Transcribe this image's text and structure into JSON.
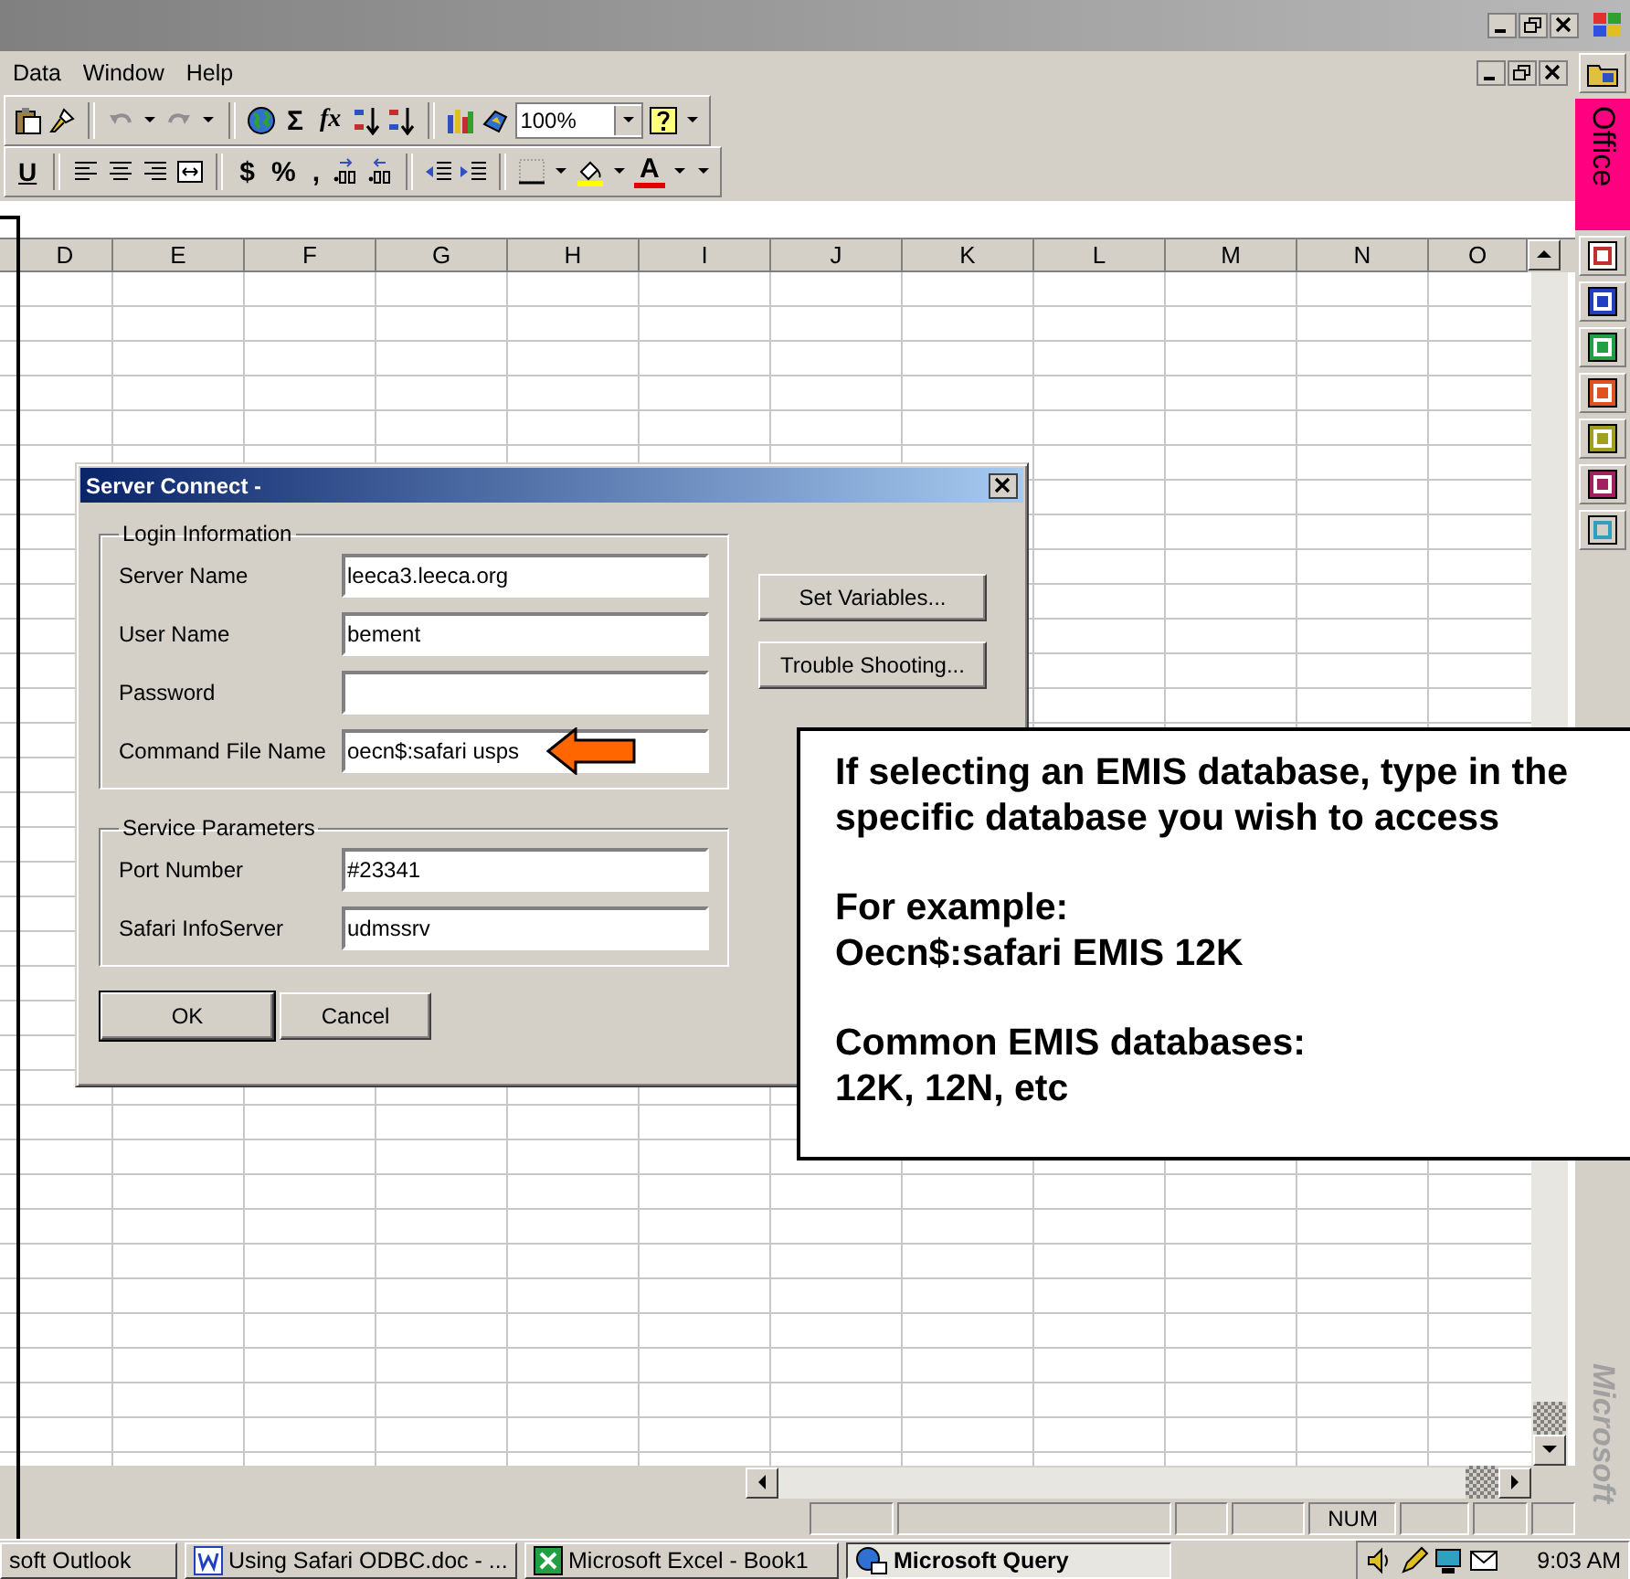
{
  "menu": [
    {
      "label": "Data"
    },
    {
      "label": "Window"
    },
    {
      "label": "Help"
    }
  ],
  "toolbar_standard": {
    "sum": "Σ",
    "function": "fx",
    "zoom": "100%"
  },
  "toolbar_formatting": {
    "underline": "U",
    "currency": "$",
    "percent": "%",
    "comma": ",",
    "font_color": "A"
  },
  "columns": [
    "D",
    "E",
    "F",
    "G",
    "H",
    "I",
    "J",
    "K",
    "L",
    "M",
    "N",
    "O"
  ],
  "dialog": {
    "title": "Server Connect -",
    "groups": [
      {
        "title": "Login Information",
        "fields": [
          {
            "label": "Server Name",
            "value": "leeca3.leeca.org"
          },
          {
            "label": "User Name",
            "value": "bement"
          },
          {
            "label": "Password"
          },
          {
            "label": "Command File Name",
            "value": "oecn$:safari usps"
          }
        ]
      },
      {
        "title": "Service Parameters",
        "fields": [
          {
            "label": "Port Number",
            "value": "#23341"
          },
          {
            "label": "Safari InfoServer",
            "value": "udmssrv"
          }
        ]
      }
    ],
    "buttons": [
      {
        "label": "OK",
        "default": true
      },
      {
        "label": "Cancel",
        "default": false
      }
    ],
    "side_buttons": [
      {
        "label": "Set Variables..."
      },
      {
        "label": "Trouble Shooting..."
      }
    ]
  },
  "callout": {
    "paragraphs": [
      [
        "If selecting an EMIS database, type in the specific database you wish to access"
      ],
      [
        "For example:",
        "Oecn$:safari EMIS 12K"
      ],
      [
        "Common EMIS databases:",
        "12K, 12N, etc"
      ]
    ]
  },
  "office_bar": {
    "title": "Office",
    "brand": "Microsoft"
  },
  "status_bar": {
    "num": "NUM"
  },
  "taskbar": {
    "buttons": [
      {
        "label": "soft Outlook",
        "kind": "outlook",
        "selected": false
      },
      {
        "label": "Using Safari ODBC.doc - ...",
        "kind": "word",
        "selected": false
      },
      {
        "label": "Microsoft Excel - Book1",
        "kind": "excel",
        "selected": false
      },
      {
        "label": "Microsoft Query",
        "kind": "query",
        "selected": true
      }
    ],
    "clock": "9:03 AM"
  }
}
